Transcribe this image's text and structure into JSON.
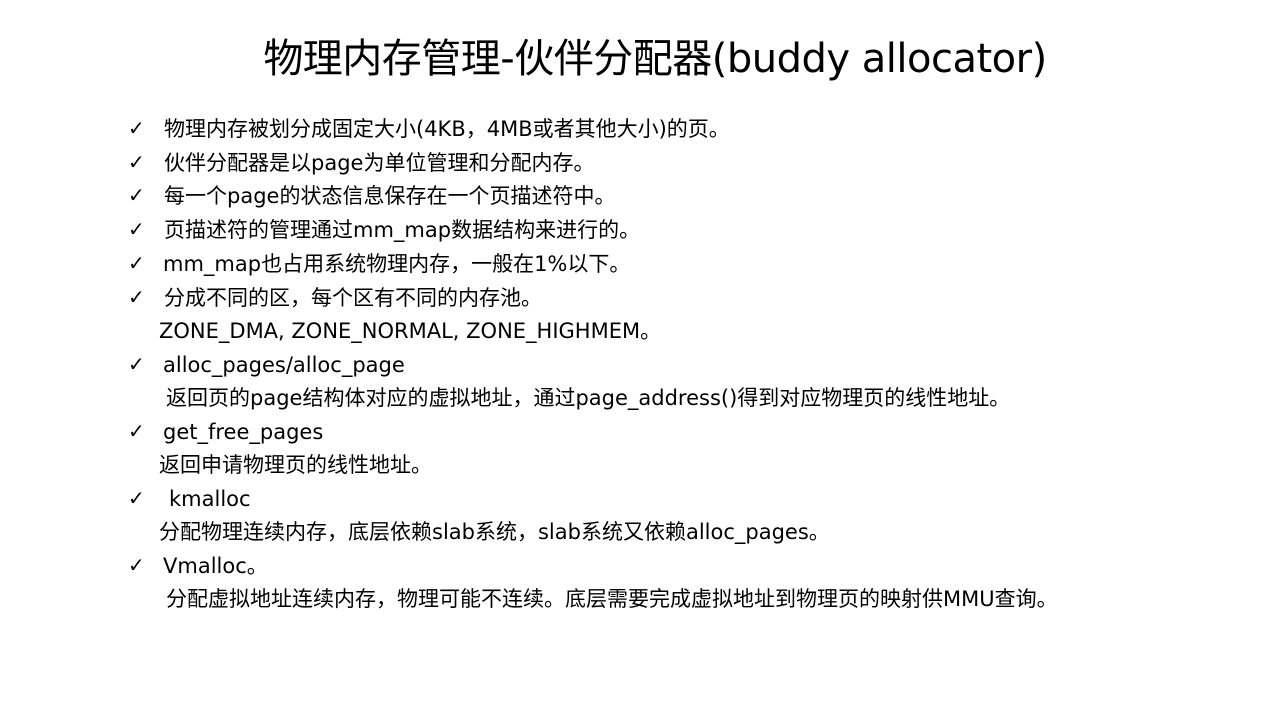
{
  "slide": {
    "title": "物理内存管理-伙伴分配器(buddy allocator)",
    "check_glyph": "✓",
    "items": [
      {
        "text": "物理内存被划分成固定大小(4KB，4MB或者其他大小)的页。",
        "detail": ""
      },
      {
        "text": "伙伴分配器是以page为单位管理和分配内存。",
        "detail": ""
      },
      {
        "text": "每一个page的状态信息保存在一个页描述符中。",
        "detail": ""
      },
      {
        "text": "页描述符的管理通过mm_map数据结构来进行的。",
        "detail": ""
      },
      {
        "text": "mm_map也占用系统物理内存，一般在1%以下。",
        "detail": ""
      },
      {
        "text": "分成不同的区，每个区有不同的内存池。",
        "detail": "ZONE_DMA, ZONE_NORMAL, ZONE_HIGHMEM。"
      },
      {
        "text": "alloc_pages/alloc_page",
        "detail": "返回页的page结构体对应的虚拟地址，通过page_address()得到对应物理页的线性地址。"
      },
      {
        "text": "get_free_pages",
        "detail": "返回申请物理页的线性地址。"
      },
      {
        "text": "kmalloc",
        "detail": "分配物理连续内存，底层依赖slab系统，slab系统又依赖alloc_pages。"
      },
      {
        "text": "Vmalloc。",
        "detail": "分配虚拟地址连续内存，物理可能不连续。底层需要完成虚拟地址到物理页的映射供MMU查询。"
      }
    ]
  }
}
